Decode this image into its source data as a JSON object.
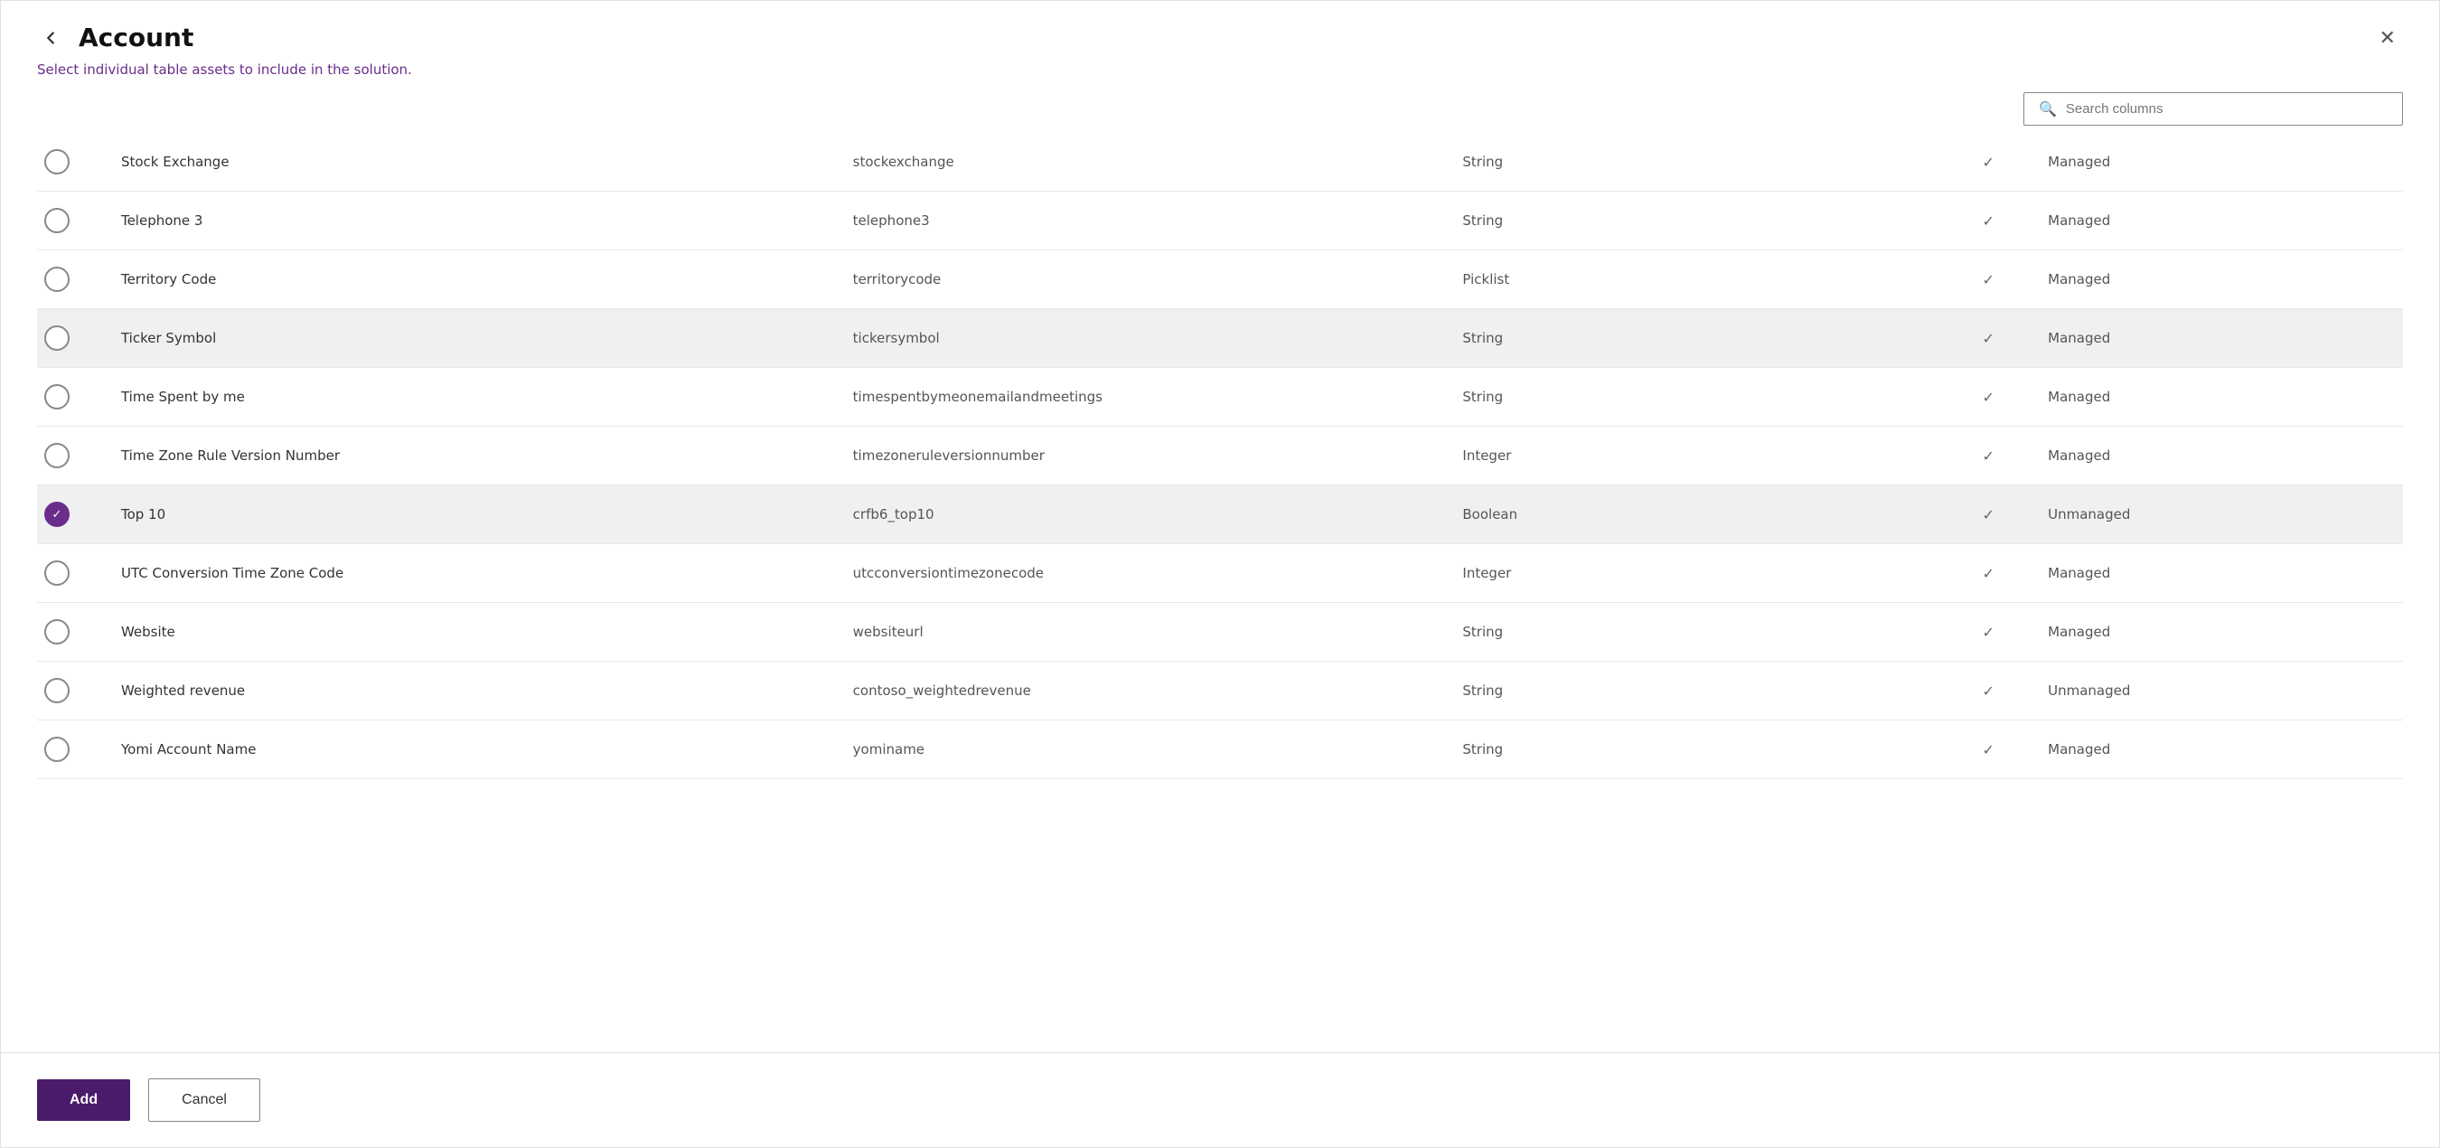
{
  "header": {
    "title": "Account",
    "back_label": "←",
    "close_label": "✕"
  },
  "subtitle": {
    "text_plain": "Select ",
    "text_highlight": "individual table assets",
    "text_end": " to include in the solution."
  },
  "search": {
    "placeholder": "Search columns",
    "value": ""
  },
  "rows": [
    {
      "id": 1,
      "checked": false,
      "selected": false,
      "name": "Stock Exchange",
      "logical_name": "stockexchange",
      "type": "String",
      "customizable": true,
      "managed": "Managed"
    },
    {
      "id": 2,
      "checked": false,
      "selected": false,
      "name": "Telephone 3",
      "logical_name": "telephone3",
      "type": "String",
      "customizable": true,
      "managed": "Managed"
    },
    {
      "id": 3,
      "checked": false,
      "selected": false,
      "name": "Territory Code",
      "logical_name": "territorycode",
      "type": "Picklist",
      "customizable": true,
      "managed": "Managed"
    },
    {
      "id": 4,
      "checked": false,
      "selected": true,
      "name": "Ticker Symbol",
      "logical_name": "tickersymbol",
      "type": "String",
      "customizable": true,
      "managed": "Managed"
    },
    {
      "id": 5,
      "checked": false,
      "selected": false,
      "name": "Time Spent by me",
      "logical_name": "timespentbymeonemailandmeetings",
      "type": "String",
      "customizable": true,
      "managed": "Managed"
    },
    {
      "id": 6,
      "checked": false,
      "selected": false,
      "name": "Time Zone Rule Version Number",
      "logical_name": "timezoneruleversionnumber",
      "type": "Integer",
      "customizable": true,
      "managed": "Managed"
    },
    {
      "id": 7,
      "checked": true,
      "selected": true,
      "name": "Top 10",
      "logical_name": "crfb6_top10",
      "type": "Boolean",
      "customizable": true,
      "managed": "Unmanaged"
    },
    {
      "id": 8,
      "checked": false,
      "selected": false,
      "name": "UTC Conversion Time Zone Code",
      "logical_name": "utcconversiontimezonecode",
      "type": "Integer",
      "customizable": true,
      "managed": "Managed"
    },
    {
      "id": 9,
      "checked": false,
      "selected": false,
      "name": "Website",
      "logical_name": "websiteurl",
      "type": "String",
      "customizable": true,
      "managed": "Managed"
    },
    {
      "id": 10,
      "checked": false,
      "selected": false,
      "name": "Weighted revenue",
      "logical_name": "contoso_weightedrevenue",
      "type": "String",
      "customizable": true,
      "managed": "Unmanaged"
    },
    {
      "id": 11,
      "checked": false,
      "selected": false,
      "name": "Yomi Account Name",
      "logical_name": "yominame",
      "type": "String",
      "customizable": true,
      "managed": "Managed"
    }
  ],
  "footer": {
    "add_label": "Add",
    "cancel_label": "Cancel"
  }
}
